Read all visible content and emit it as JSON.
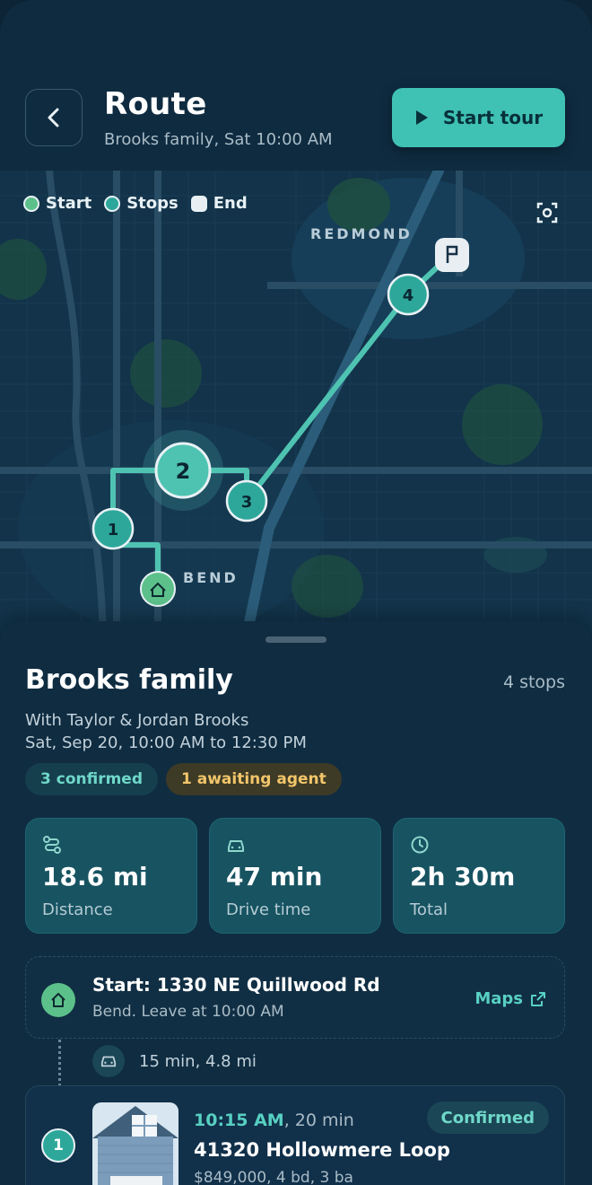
{
  "header": {
    "title": "Route",
    "subtitle": "Brooks family, Sat 10:00 AM",
    "start_tour_label": "Start tour"
  },
  "legend": {
    "start": "Start",
    "stops": "Stops",
    "end": "End"
  },
  "map": {
    "city_north": "REDMOND",
    "city_south": "BEND",
    "markers": [
      "1",
      "2",
      "3",
      "4"
    ]
  },
  "sheet": {
    "title": "Brooks family",
    "stops_count": "4 stops",
    "with": "With Taylor & Jordan Brooks",
    "when": "Sat, Sep 20, 10:00 AM to 12:30 PM",
    "badges": {
      "confirmed": "3 confirmed",
      "awaiting": "1 awaiting agent"
    },
    "stats": [
      {
        "value": "18.6 mi",
        "label": "Distance",
        "icon": "route-icon"
      },
      {
        "value": "47 min",
        "label": "Drive time",
        "icon": "car-icon"
      },
      {
        "value": "2h 30m",
        "label": "Total",
        "icon": "clock-icon"
      }
    ],
    "start": {
      "title": "Start: 1330 NE Quillwood Rd",
      "sub": "Bend. Leave at 10:00 AM",
      "maps_label": "Maps"
    },
    "drive_segment": "15 min, 4.8 mi",
    "stop1": {
      "number": "1",
      "time": "10:15 AM",
      "duration": ", 20 min",
      "address": "41320 Hollowmere Loop",
      "details": "$849,000, 4 bd, 3 ba",
      "status": "Confirmed"
    }
  },
  "colors": {
    "accent": "#3fc1b4",
    "background": "#0e2a3e",
    "start_green": "#5cc08a",
    "awaiting": "#f2c56a"
  }
}
